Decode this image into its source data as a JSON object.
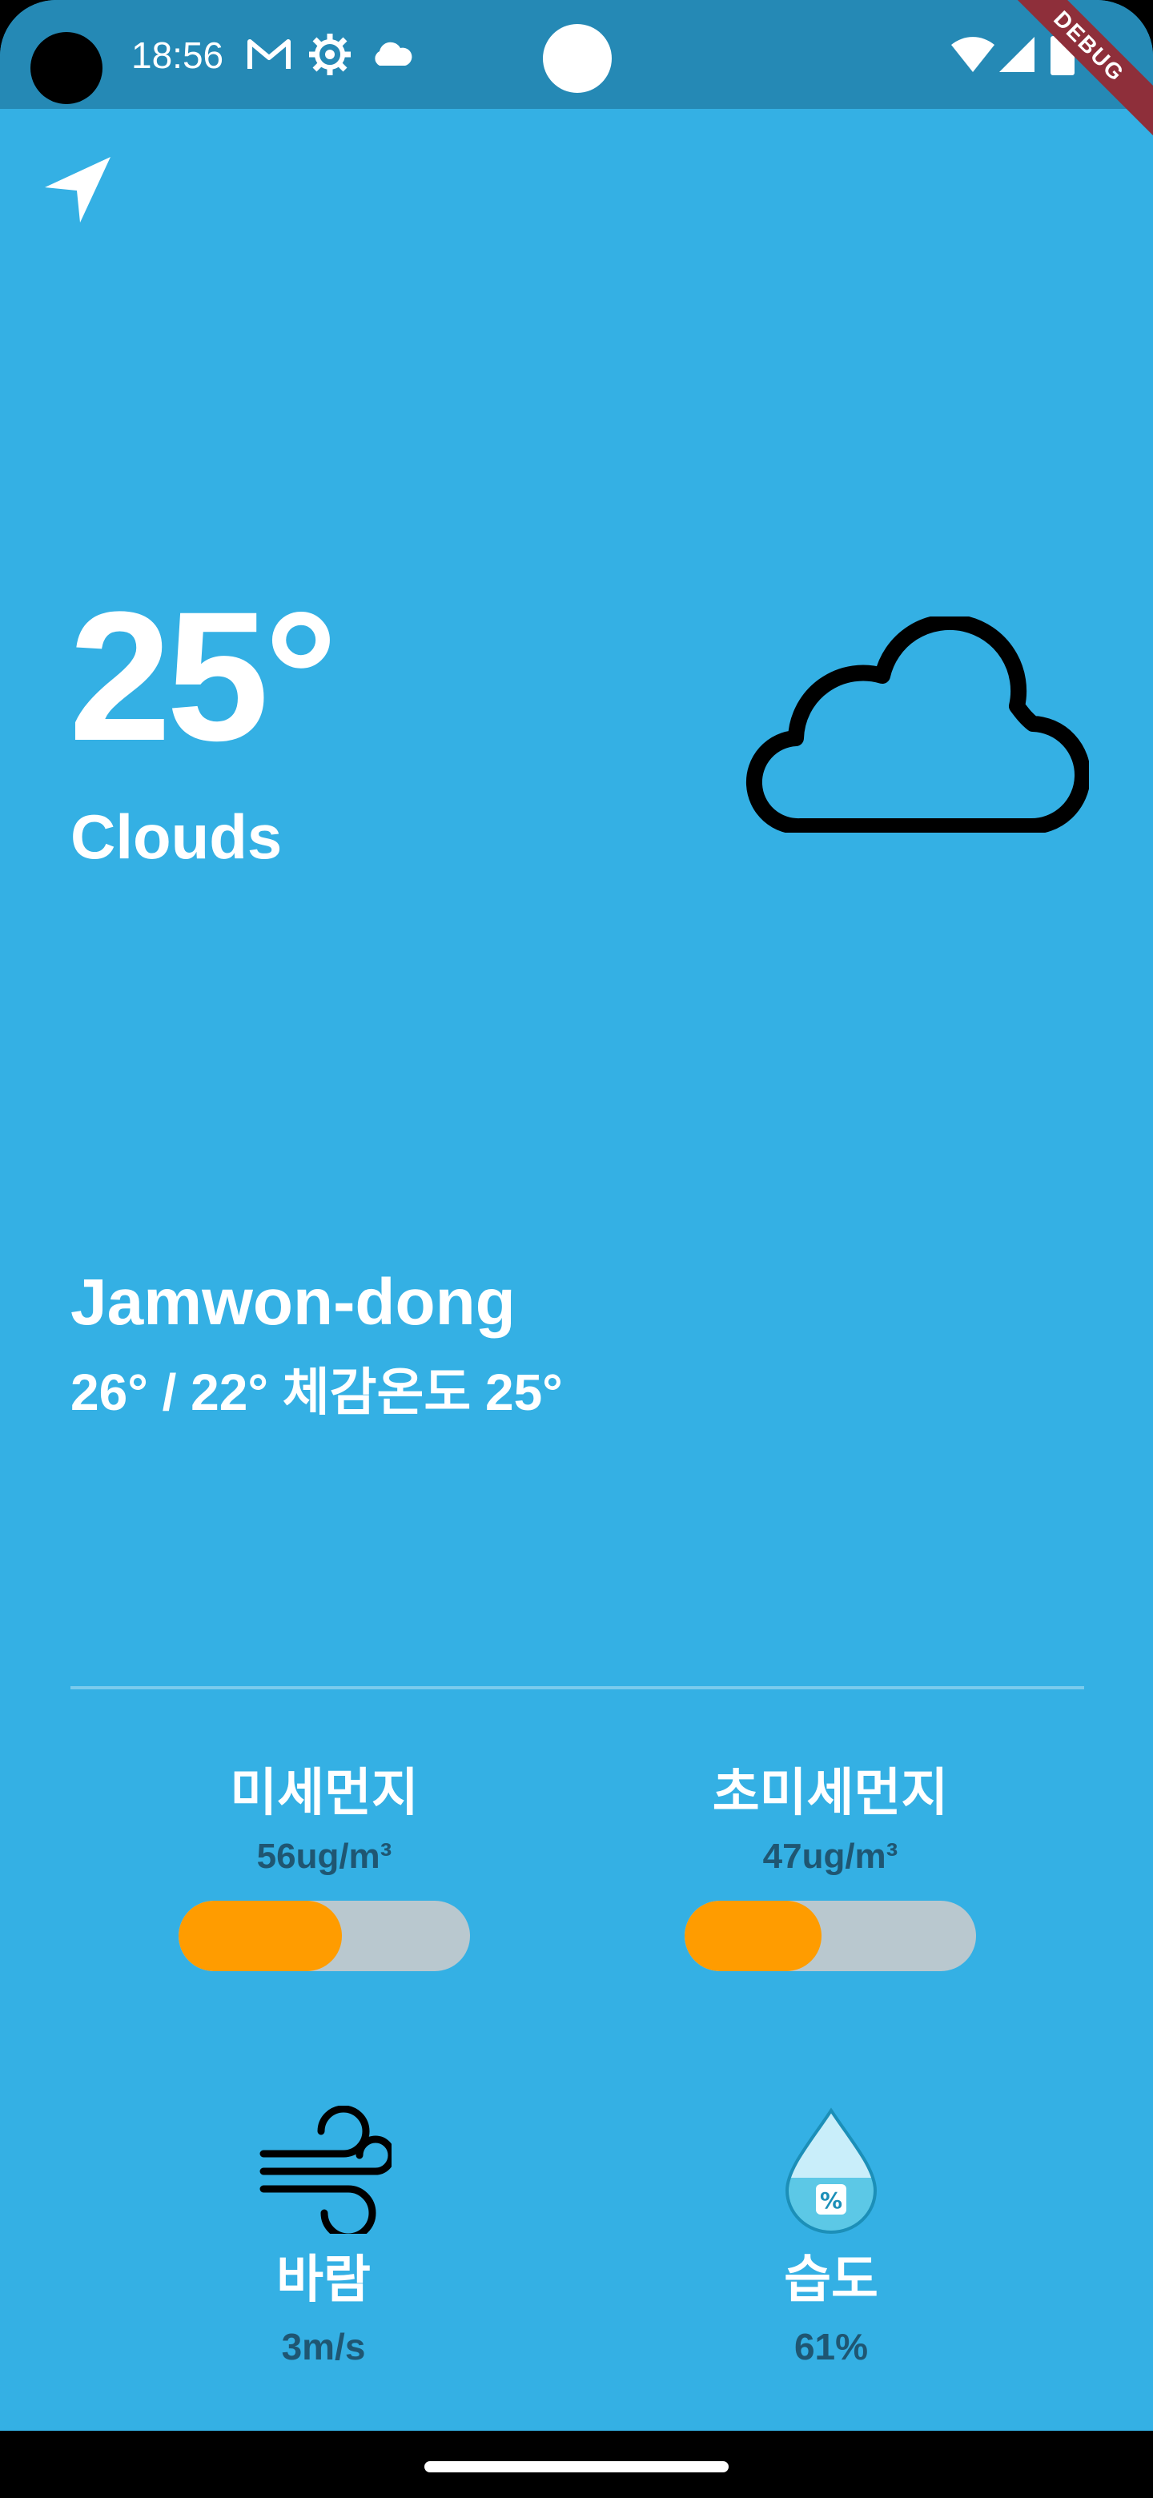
{
  "status_bar": {
    "time": "18:56",
    "icons": [
      "gmail-icon",
      "settings-gear-icon",
      "cloud-notification-icon",
      "wifi-icon",
      "signal-icon",
      "battery-icon"
    ]
  },
  "debug_banner": "DEBUG",
  "weather": {
    "temperature": "25°",
    "condition": "Clouds",
    "icon": "cloud-icon",
    "city": "Jamwon-dong",
    "range": "26° / 22°  체감온도 25°"
  },
  "dust": {
    "pm10": {
      "label": "미세먼지",
      "value": "56ug/m³",
      "level": 0.56
    },
    "pm25": {
      "label": "초미세먼지",
      "value": "47ug/m³",
      "level": 0.47
    }
  },
  "wind": {
    "label": "바람",
    "value": "3m/s",
    "icon": "wind-icon"
  },
  "humidity": {
    "label": "습도",
    "value": "61%",
    "icon": "humidity-drop-icon"
  },
  "colors": {
    "background": "#34b0e4",
    "status_bar": "#2589b5",
    "bar_fill": "#ff9c00",
    "bar_track": "#b9c8cf",
    "value_text": "#1f5672"
  }
}
